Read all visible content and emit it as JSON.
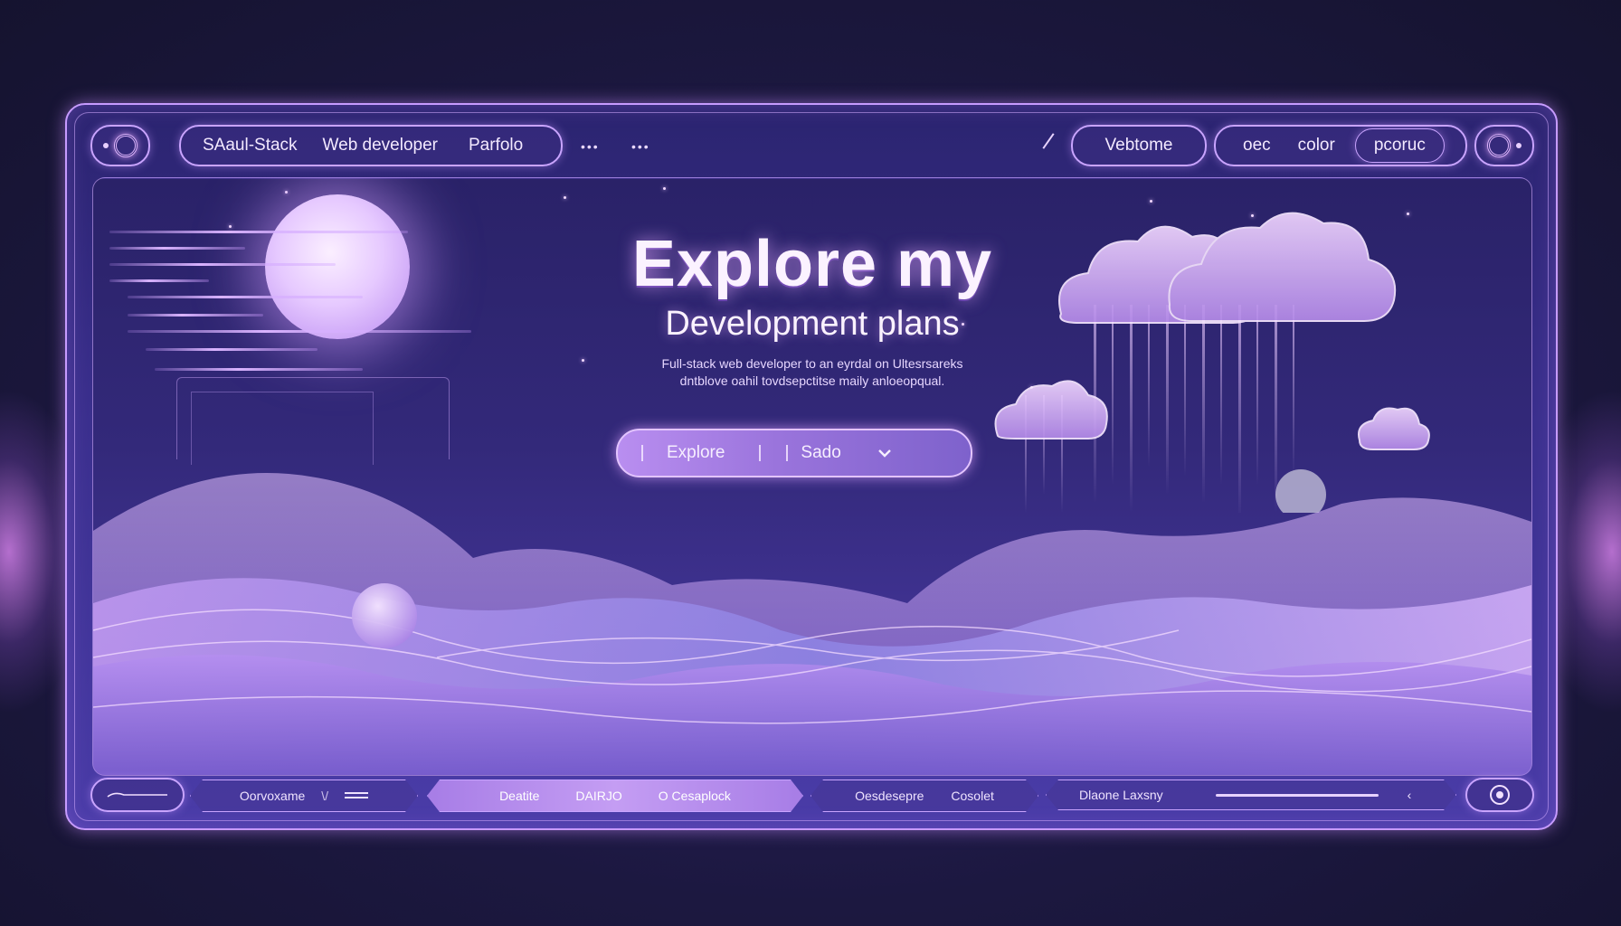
{
  "topbar": {
    "left_label": "SAaul-Stack",
    "nav": [
      "Web developer",
      "Parfolo"
    ],
    "dots": [
      "•••",
      "•••"
    ],
    "right_button": "Vebtome",
    "right_nav": [
      "oec",
      "color"
    ],
    "right_pill": "pcoruc"
  },
  "hero": {
    "title": "Explore my",
    "subtitle": "Development plans",
    "description_lines": [
      "Full-stack web developer to an eyrdal on Ultesrsareks",
      "dntblove oahil tovdsepctitse maily anloeopqual."
    ],
    "search": {
      "left_label": "Explore",
      "right_label": "Sado"
    }
  },
  "bottombar": {
    "tabs": [
      "Oorvoxame",
      "Deatite",
      "DAIRJO",
      "O Cesaplock",
      "Oesdesepre",
      "Cosolet",
      "Dlaone Laxsny"
    ]
  },
  "icons": {
    "top_left": "spiral-icon",
    "top_right": "spiral-icon",
    "search_chevron": "chevron-down-icon",
    "bottom_left": "wave-icon",
    "bottom_right": "target-icon",
    "top_slash": "slash-icon",
    "bottom_menu": "menu-lines-icon",
    "bottom_chevron": "chevron-left-icon"
  },
  "colors": {
    "accent": "#c79bff",
    "background": "#1c1840",
    "glow": "#e8b8ff"
  }
}
